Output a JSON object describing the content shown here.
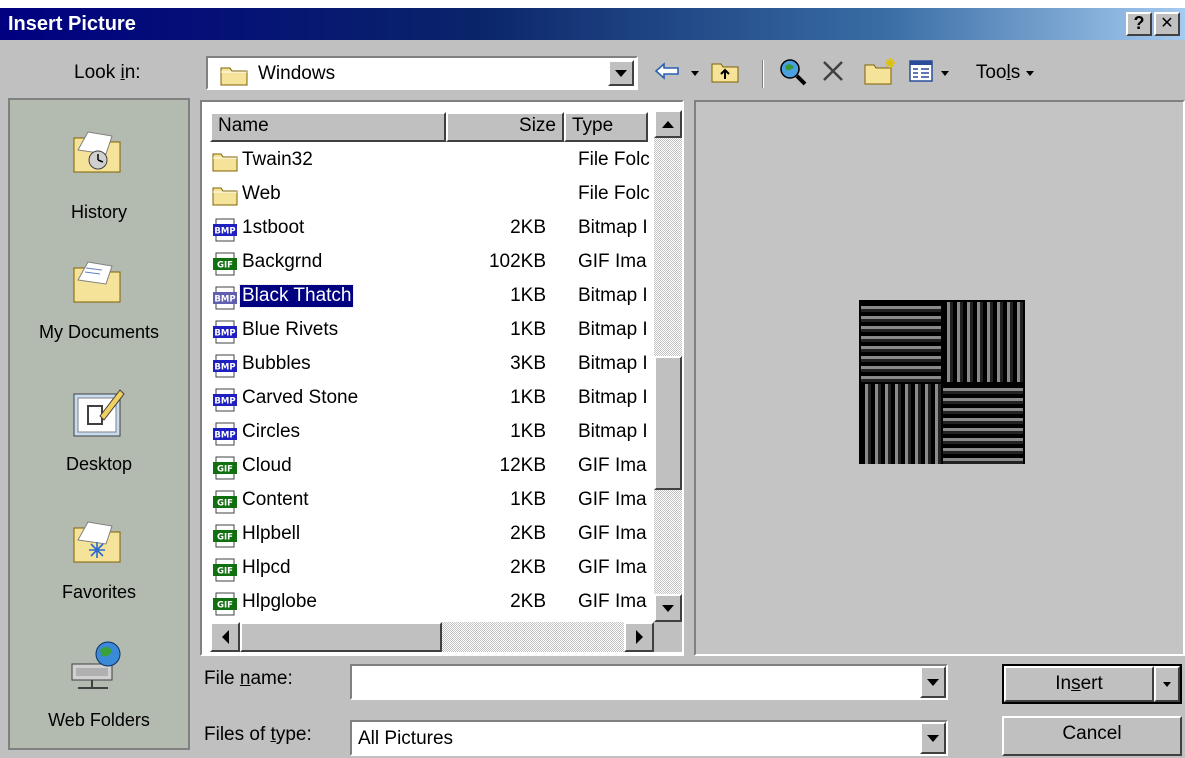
{
  "window": {
    "title": "Insert Picture",
    "help_label": "?",
    "close_label": "✕"
  },
  "lookin": {
    "label_pre": "Look ",
    "label_accel": "i",
    "label_post": "n:",
    "value": "Windows"
  },
  "toolbar": {
    "icons": [
      "back-arrow-icon",
      "up-one-level-icon",
      "search-web-icon",
      "delete-icon",
      "new-folder-icon",
      "views-icon"
    ],
    "tools_label_pre": "Too",
    "tools_label_accel": "l",
    "tools_label_post": "s"
  },
  "places": [
    {
      "label": "History",
      "icon": "history-icon"
    },
    {
      "label": "My Documents",
      "icon": "my-documents-icon"
    },
    {
      "label": "Desktop",
      "icon": "desktop-icon"
    },
    {
      "label": "Favorites",
      "icon": "favorites-icon"
    },
    {
      "label": "Web Folders",
      "icon": "web-folders-icon"
    }
  ],
  "filelist": {
    "columns": [
      "Name",
      "Size",
      "Type"
    ],
    "rows": [
      {
        "name": "Twain32",
        "size": "",
        "type": "File Folc",
        "icon": "folder"
      },
      {
        "name": "Web",
        "size": "",
        "type": "File Folc",
        "icon": "folder"
      },
      {
        "name": "1stboot",
        "size": "2KB",
        "type": "Bitmap I",
        "icon": "bmp"
      },
      {
        "name": "Backgrnd",
        "size": "102KB",
        "type": "GIF Ima",
        "icon": "gif"
      },
      {
        "name": "Black Thatch",
        "size": "1KB",
        "type": "Bitmap I",
        "icon": "bmp",
        "selected": true
      },
      {
        "name": "Blue Rivets",
        "size": "1KB",
        "type": "Bitmap I",
        "icon": "bmp"
      },
      {
        "name": "Bubbles",
        "size": "3KB",
        "type": "Bitmap I",
        "icon": "bmp"
      },
      {
        "name": "Carved Stone",
        "size": "1KB",
        "type": "Bitmap I",
        "icon": "bmp"
      },
      {
        "name": "Circles",
        "size": "1KB",
        "type": "Bitmap I",
        "icon": "bmp"
      },
      {
        "name": "Cloud",
        "size": "12KB",
        "type": "GIF Ima",
        "icon": "gif"
      },
      {
        "name": "Content",
        "size": "1KB",
        "type": "GIF Ima",
        "icon": "gif"
      },
      {
        "name": "Hlpbell",
        "size": "2KB",
        "type": "GIF Ima",
        "icon": "gif"
      },
      {
        "name": "Hlpcd",
        "size": "2KB",
        "type": "GIF Ima",
        "icon": "gif"
      },
      {
        "name": "Hlpglobe",
        "size": "2KB",
        "type": "GIF Ima",
        "icon": "gif"
      }
    ],
    "bmp_badge": "BMP",
    "gif_badge": "GIF"
  },
  "filename": {
    "label_pre": "File ",
    "label_accel": "n",
    "label_post": "ame:",
    "value": ""
  },
  "filetype": {
    "label_pre": "Files of ",
    "label_accel": "t",
    "label_post": "ype:",
    "value": "All Pictures"
  },
  "buttons": {
    "insert_pre": "In",
    "insert_accel": "s",
    "insert_post": "ert",
    "cancel": "Cancel"
  },
  "colors": {
    "titlebar_start": "#000080",
    "selection": "#000080",
    "face": "#c0c0c0",
    "places_bg": "#b3bab0"
  }
}
